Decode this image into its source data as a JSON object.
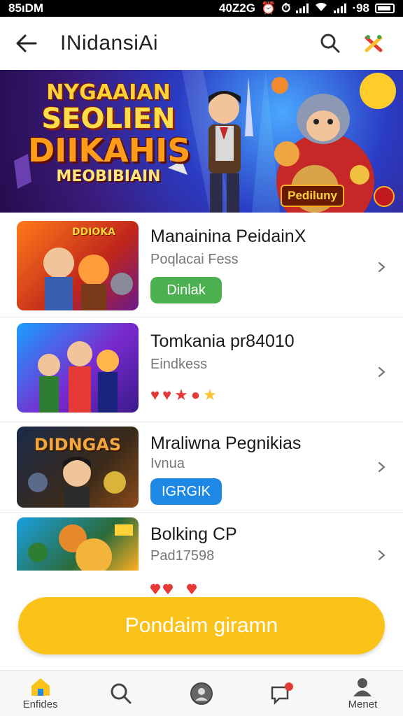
{
  "status_bar": {
    "time": "85ıDM",
    "carrier": "40Z2G",
    "battery_text": "·98"
  },
  "header": {
    "title": "INidansiAi"
  },
  "banner": {
    "lines": [
      "NYGAAIAN",
      "SEOLIEN",
      "DIIKAHIS",
      "MEOBIBIAIN"
    ],
    "badge": "Pediluny"
  },
  "games": [
    {
      "title": "Manainina PeidainX",
      "subtitle": "Poqlacai Fess",
      "button": "Dinlak",
      "button_color": "#4caf50",
      "thumb_label": "DDIOKA"
    },
    {
      "title": "Tomkania pr84010",
      "subtitle": "Eindkess",
      "rating_glyphs": [
        "♥",
        "♥",
        "★",
        "●",
        "★"
      ]
    },
    {
      "title": "Mraliwna Pegnikias",
      "subtitle": "Ivnua",
      "button": "IGRGIK",
      "button_color": "#1e88e5",
      "thumb_label": "DIDNGAS"
    },
    {
      "title": "Bolking CP",
      "subtitle": "Pad17598"
    }
  ],
  "cta": {
    "label": "Pondaim giramn"
  },
  "bottom_nav": [
    {
      "label": "Enfides",
      "icon": "home-icon"
    },
    {
      "label": "",
      "icon": "search-icon"
    },
    {
      "label": "",
      "icon": "profile-circle-icon"
    },
    {
      "label": "",
      "icon": "chat-icon"
    },
    {
      "label": "Menet",
      "icon": "user-icon"
    }
  ],
  "colors": {
    "accent": "#fbc21a",
    "green": "#4caf50",
    "blue": "#1e88e5"
  }
}
